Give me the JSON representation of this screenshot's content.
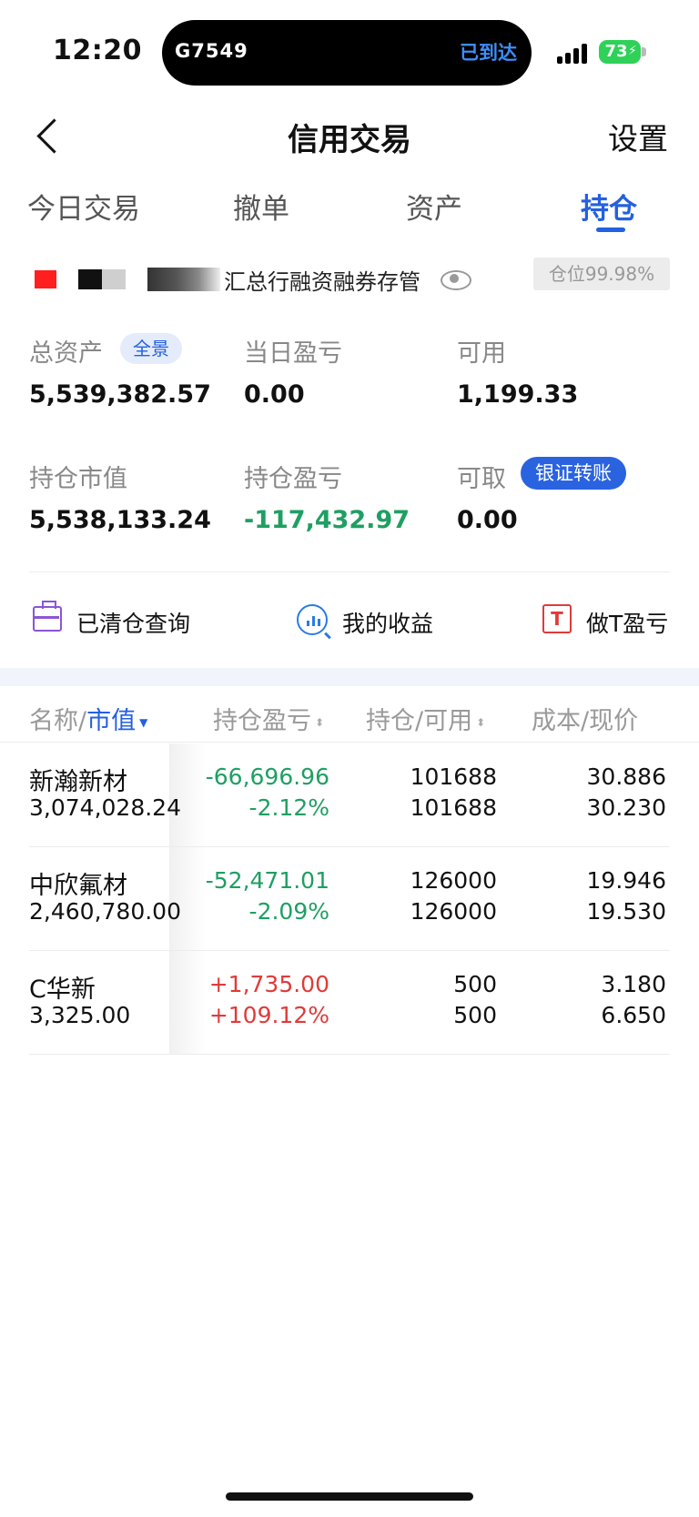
{
  "status_bar": {
    "time": "12:20",
    "island_code": "G7549",
    "island_status": "已到达",
    "battery": "73",
    "icons": [
      "signal-icon",
      "battery-charging-icon"
    ]
  },
  "nav": {
    "title": "信用交易",
    "settings": "设置",
    "back_icon": "chevron-left-icon"
  },
  "tabs": [
    {
      "label": "今日交易",
      "active": false
    },
    {
      "label": "撤单",
      "active": false
    },
    {
      "label": "资产",
      "active": false
    },
    {
      "label": "持仓",
      "active": true
    }
  ],
  "account": {
    "name_suffix": "汇总行融资融券存管",
    "position_ratio": "仓位99.98%"
  },
  "metrics": {
    "total_assets_label": "总资产",
    "panorama": "全景",
    "total_assets": "5,539,382.57",
    "day_pnl_label": "当日盈亏",
    "day_pnl": "0.00",
    "available_label": "可用",
    "available": "1,199.33",
    "market_value_label": "持仓市值",
    "market_value": "5,538,133.24",
    "position_pnl_label": "持仓盈亏",
    "position_pnl": "-117,432.97",
    "withdrawable_label": "可取",
    "bank_transfer": "银证转账",
    "withdrawable": "0.00"
  },
  "quick_actions": [
    {
      "label": "已清仓查询",
      "icon": "briefcase-icon"
    },
    {
      "label": "我的收益",
      "icon": "chart-search-icon"
    },
    {
      "label": "做T盈亏",
      "icon": "t-box-icon"
    }
  ],
  "table": {
    "headers": {
      "name": "名称/",
      "name_sort": "市值",
      "pnl": "持仓盈亏",
      "qty": "持仓/可用",
      "price": "成本/现价"
    },
    "rows": [
      {
        "name": "新瀚新材",
        "market_value": "3,074,028.24",
        "pnl": "-66,696.96",
        "pnl_pct": "-2.12%",
        "holding": "101688",
        "available": "101688",
        "cost": "30.886",
        "price": "30.230",
        "sign": "neg"
      },
      {
        "name": "中欣氟材",
        "market_value": "2,460,780.00",
        "pnl": "-52,471.01",
        "pnl_pct": "-2.09%",
        "holding": "126000",
        "available": "126000",
        "cost": "19.946",
        "price": "19.530",
        "sign": "neg"
      },
      {
        "name": "C华新",
        "market_value": "3,325.00",
        "pnl": "+1,735.00",
        "pnl_pct": "+109.12%",
        "holding": "500",
        "available": "500",
        "cost": "3.180",
        "price": "6.650",
        "sign": "pos"
      }
    ]
  },
  "colors": {
    "accent": "#2460e0",
    "loss": "#1f9f63",
    "gain": "#e03a3a"
  }
}
